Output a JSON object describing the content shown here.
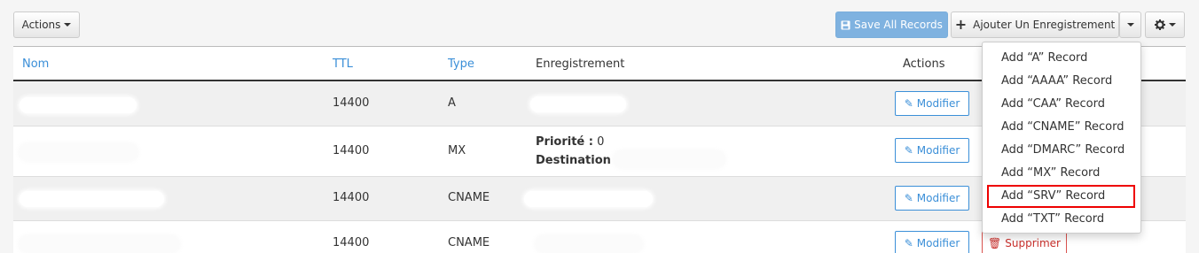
{
  "toolbar": {
    "actions_label": "Actions",
    "save_all_label": "Save All Records",
    "add_record_label": "Ajouter Un Enregistrement"
  },
  "table": {
    "headers": {
      "name": "Nom",
      "ttl": "TTL",
      "type": "Type",
      "record": "Enregistrement",
      "actions": "Actions"
    },
    "rows": [
      {
        "ttl": "14400",
        "type": "A"
      },
      {
        "ttl": "14400",
        "type": "MX",
        "priority_label": "Priorité :",
        "priority_value": "0",
        "destination_label": "Destination :"
      },
      {
        "ttl": "14400",
        "type": "CNAME"
      },
      {
        "ttl": "14400",
        "type": "CNAME"
      }
    ],
    "edit_label": "Modifier",
    "delete_label": "Supprimer"
  },
  "add_menu": {
    "items": [
      "Add “A” Record",
      "Add “AAAA” Record",
      "Add “CAA” Record",
      "Add “CNAME” Record",
      "Add “DMARC” Record",
      "Add “MX” Record",
      "Add “SRV” Record",
      "Add “TXT” Record"
    ],
    "highlighted_index": 6
  },
  "colors": {
    "link": "#3b8fd8",
    "save_button": "#7fb2e0",
    "delete": "#d9534f",
    "highlight_box": "#ee0000"
  }
}
